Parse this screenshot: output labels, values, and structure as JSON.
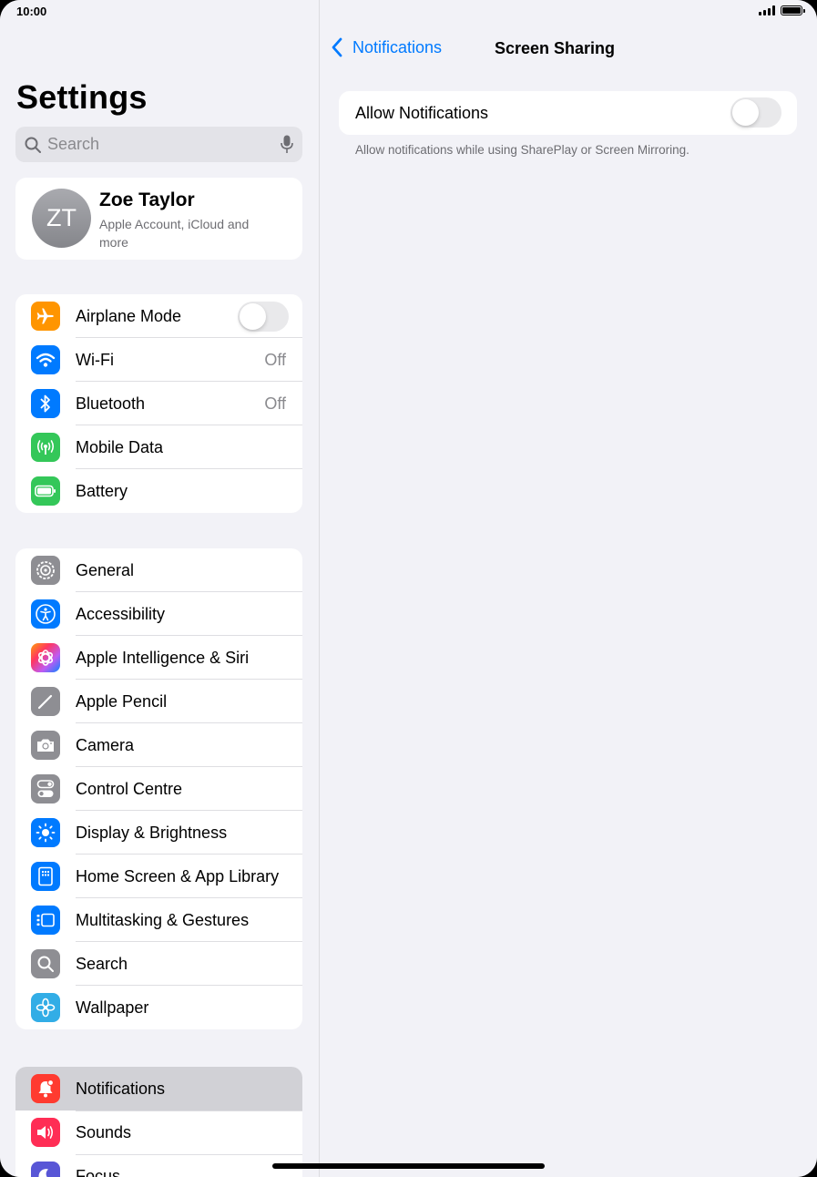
{
  "status_bar": {
    "time": "10:00"
  },
  "sidebar": {
    "title": "Settings",
    "search_placeholder": "Search",
    "profile": {
      "initials": "ZT",
      "name": "Zoe Taylor",
      "subtitle": "Apple Account, iCloud and more"
    },
    "group1": [
      {
        "label": "Airplane Mode",
        "icon": "airplane-icon",
        "color": "#ff9500",
        "toggle": false
      },
      {
        "label": "Wi-Fi",
        "icon": "wifi-icon",
        "color": "#007aff",
        "value": "Off"
      },
      {
        "label": "Bluetooth",
        "icon": "bluetooth-icon",
        "color": "#007aff",
        "value": "Off"
      },
      {
        "label": "Mobile Data",
        "icon": "antenna-icon",
        "color": "#34c759"
      },
      {
        "label": "Battery",
        "icon": "battery-icon",
        "color": "#34c759"
      }
    ],
    "group2": [
      {
        "label": "General",
        "icon": "gear-icon",
        "color": "#8e8e93"
      },
      {
        "label": "Accessibility",
        "icon": "accessibility-icon",
        "color": "#007aff"
      },
      {
        "label": "Apple Intelligence & Siri",
        "icon": "apple-intelligence-icon",
        "color": "#ff6b6b"
      },
      {
        "label": "Apple Pencil",
        "icon": "pencil-icon",
        "color": "#8e8e93"
      },
      {
        "label": "Camera",
        "icon": "camera-icon",
        "color": "#8e8e93"
      },
      {
        "label": "Control Centre",
        "icon": "switches-icon",
        "color": "#8e8e93"
      },
      {
        "label": "Display & Brightness",
        "icon": "sun-icon",
        "color": "#007aff"
      },
      {
        "label": "Home Screen & App Library",
        "icon": "home-screen-icon",
        "color": "#007aff"
      },
      {
        "label": "Multitasking & Gestures",
        "icon": "multitasking-icon",
        "color": "#007aff"
      },
      {
        "label": "Search",
        "icon": "search-icon",
        "color": "#8e8e93"
      },
      {
        "label": "Wallpaper",
        "icon": "flower-icon",
        "color": "#32ade6"
      }
    ],
    "group3": [
      {
        "label": "Notifications",
        "icon": "bell-icon",
        "color": "#ff3b30",
        "selected": true
      },
      {
        "label": "Sounds",
        "icon": "speaker-icon",
        "color": "#ff2d55"
      },
      {
        "label": "Focus",
        "icon": "moon-icon",
        "color": "#5856d6"
      }
    ]
  },
  "detail": {
    "back_label": "Notifications",
    "title": "Screen Sharing",
    "allow_label": "Allow Notifications",
    "allow_enabled": false,
    "footnote": "Allow notifications while using SharePlay or Screen Mirroring."
  }
}
